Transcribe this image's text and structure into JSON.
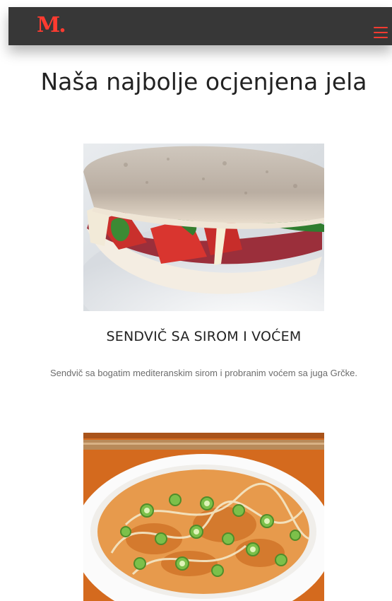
{
  "header": {
    "logo_text": "M.",
    "brand_color": "#ff3b30",
    "background": "#373737",
    "menu_icon": "hamburger-menu-icon"
  },
  "main": {
    "title": "Naša najbolje ocjenjena jela",
    "dishes": [
      {
        "name": "SENDVIČ SA SIROM I VOĆEM",
        "description": "Sendvič sa bogatim mediteranskim sirom i probranim voćem sa juga Grčke.",
        "image": "sandwich-photo"
      },
      {
        "name": "",
        "description": "",
        "image": "rice-bowl-photo"
      }
    ]
  }
}
